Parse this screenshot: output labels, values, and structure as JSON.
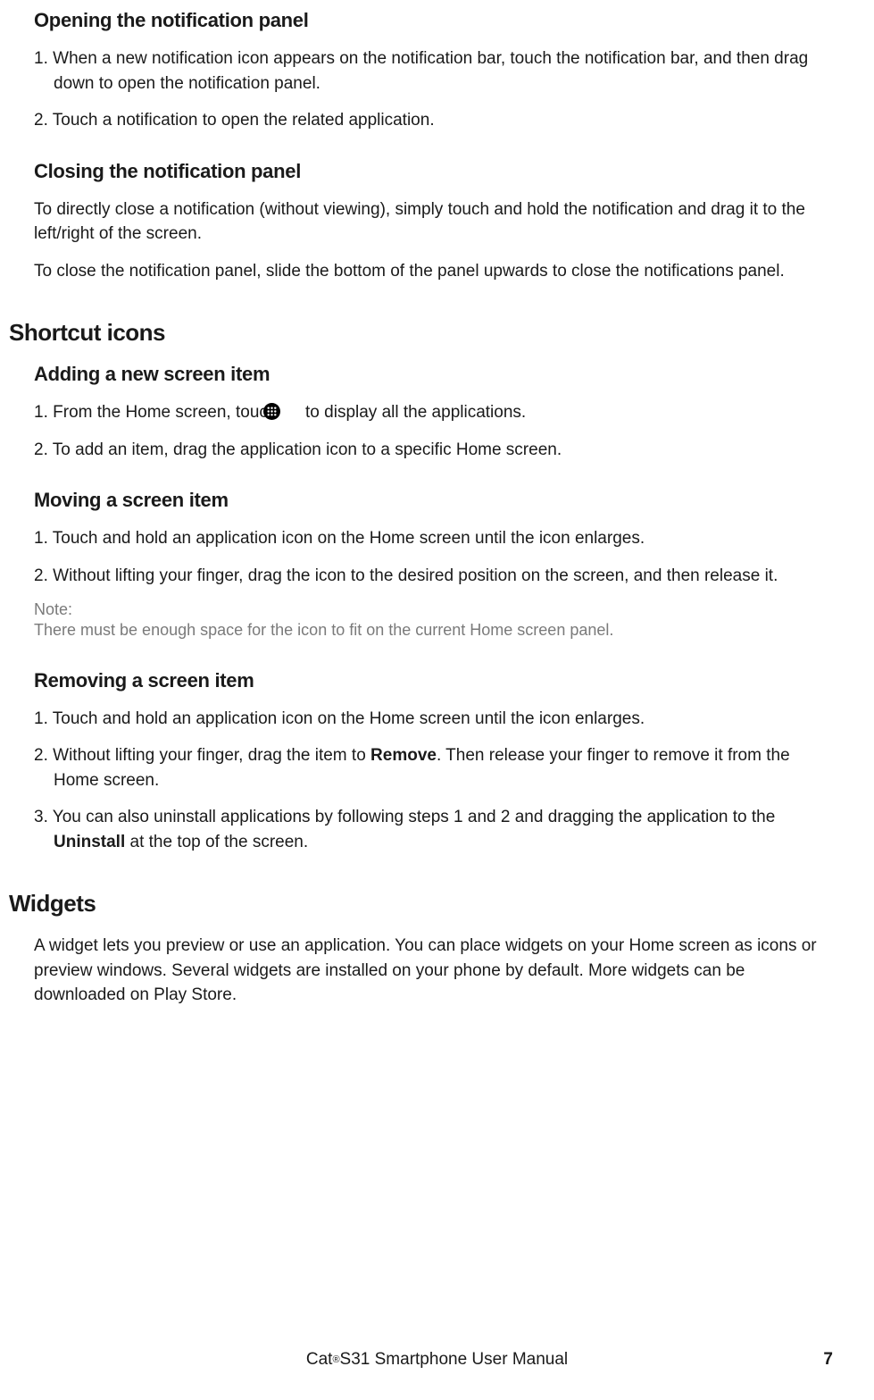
{
  "sections": {
    "opening": {
      "heading": "Opening the notification panel",
      "items": [
        "When a new notification icon appears on the notification bar, touch the notification bar, and then drag down to open the notification panel.",
        "Touch a notification to open the related application."
      ]
    },
    "closing": {
      "heading": "Closing the notification panel",
      "p1": "To directly close a notification (without viewing), simply touch and hold the notification and drag it to the left/right of the screen.",
      "p2": "To close the notification panel, slide the bottom of the panel upwards to close the notifications panel."
    },
    "shortcut": {
      "heading": "Shortcut icons",
      "adding": {
        "heading": "Adding a new screen item",
        "item1_pre": "From the Home screen, touch ",
        "item1_post": " to display all the applications.",
        "item2": "To add an item, drag the application icon to a specific Home screen.",
        "icon_name": "apps-grid-icon"
      },
      "moving": {
        "heading": "Moving a screen item",
        "items": [
          "Touch and hold an application icon on the Home screen until the icon enlarges.",
          "Without lifting your finger, drag the icon to the desired position on the screen, and then release it."
        ],
        "note_label": "Note:",
        "note_body": "There must be enough space for the icon to fit on the current Home screen panel."
      },
      "removing": {
        "heading": "Removing a screen item",
        "item1": "Touch and hold an application icon on the Home screen until the icon enlarges.",
        "item2_pre": "Without lifting your finger, drag the item to ",
        "item2_bold": "Remove",
        "item2_post": ". Then release your finger to remove it from the Home screen.",
        "item3_pre": "You can also uninstall applications by following steps 1 and 2 and dragging the application to the ",
        "item3_bold": "Uninstall",
        "item3_post": " at the top of the screen."
      }
    },
    "widgets": {
      "heading": "Widgets",
      "p1": "A widget lets you preview or use an application. You can place widgets on your Home screen as icons or preview windows. Several widgets are installed on your phone by default. More widgets can be downloaded on Play Store."
    }
  },
  "footer": {
    "brand_pre": "Cat",
    "brand_sup": "®",
    "brand_post": " S31 Smartphone User Manual",
    "page": "7"
  }
}
